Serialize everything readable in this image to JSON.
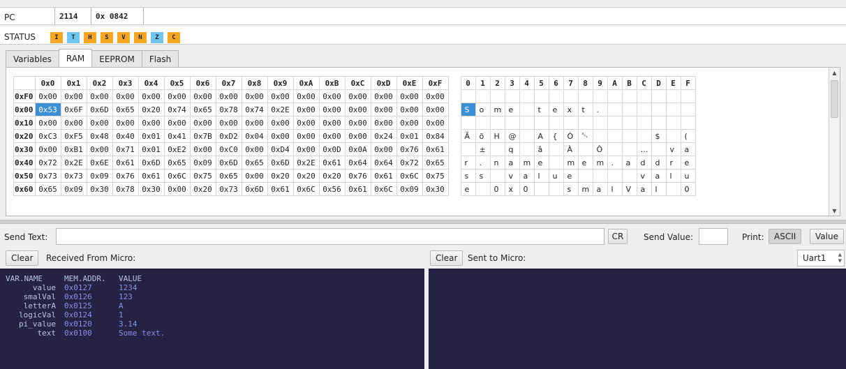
{
  "registers": {
    "pc": {
      "label": "PC",
      "decimal": "2114",
      "hex": "0x 0842"
    },
    "status": {
      "label": "STATUS",
      "flags": [
        {
          "name": "I",
          "color": "#f5a623"
        },
        {
          "name": "T",
          "color": "#6ec6ee"
        },
        {
          "name": "H",
          "color": "#f5a623"
        },
        {
          "name": "S",
          "color": "#f5a623"
        },
        {
          "name": "V",
          "color": "#f5a623"
        },
        {
          "name": "N",
          "color": "#f5a623"
        },
        {
          "name": "Z",
          "color": "#6ec6ee"
        },
        {
          "name": "C",
          "color": "#f5a623"
        }
      ]
    }
  },
  "tabs": [
    {
      "label": "Variables",
      "active": false
    },
    {
      "label": "RAM",
      "active": true
    },
    {
      "label": "EEPROM",
      "active": false
    },
    {
      "label": "Flash",
      "active": false
    }
  ],
  "memory": {
    "hex_columns": [
      "0x0",
      "0x1",
      "0x2",
      "0x3",
      "0x4",
      "0x5",
      "0x6",
      "0x7",
      "0x8",
      "0x9",
      "0xA",
      "0xB",
      "0xC",
      "0xD",
      "0xE",
      "0xF"
    ],
    "ascii_columns": [
      "0",
      "1",
      "2",
      "3",
      "4",
      "5",
      "6",
      "7",
      "8",
      "9",
      "A",
      "B",
      "C",
      "D",
      "E",
      "F"
    ],
    "selected": {
      "row": 1,
      "col": 0
    },
    "rows": [
      {
        "addr": "0xF0",
        "hex": [
          "0x00",
          "0x00",
          "0x00",
          "0x00",
          "0x00",
          "0x00",
          "0x00",
          "0x00",
          "0x00",
          "0x00",
          "0x00",
          "0x00",
          "0x00",
          "0x00",
          "0x00",
          "0x00"
        ],
        "ascii": [
          "",
          "",
          "",
          "",
          "",
          "",
          "",
          "",
          "",
          "",
          "",
          "",
          "",
          "",
          "",
          ""
        ]
      },
      {
        "addr": "0x00",
        "hex": [
          "0x53",
          "0x6F",
          "0x6D",
          "0x65",
          "0x20",
          "0x74",
          "0x65",
          "0x78",
          "0x74",
          "0x2E",
          "0x00",
          "0x00",
          "0x00",
          "0x00",
          "0x00",
          "0x00"
        ],
        "ascii": [
          "S",
          "o",
          "m",
          "e",
          "",
          "t",
          "e",
          "x",
          "t",
          ".",
          "",
          "",
          "",
          "",
          "",
          ""
        ]
      },
      {
        "addr": "0x10",
        "hex": [
          "0x00",
          "0x00",
          "0x00",
          "0x00",
          "0x00",
          "0x00",
          "0x00",
          "0x00",
          "0x00",
          "0x00",
          "0x00",
          "0x00",
          "0x00",
          "0x00",
          "0x00",
          "0x00"
        ],
        "ascii": [
          "",
          "",
          "",
          "",
          "",
          "",
          "",
          "",
          "",
          "",
          "",
          "",
          "",
          "",
          "",
          ""
        ]
      },
      {
        "addr": "0x20",
        "hex": [
          "0xC3",
          "0xF5",
          "0x48",
          "0x40",
          "0x01",
          "0x41",
          "0x7B",
          "0xD2",
          "0x04",
          "0x00",
          "0x00",
          "0x00",
          "0x00",
          "0x24",
          "0x01",
          "0x84"
        ],
        "ascii": [
          "Ã",
          "õ",
          "H",
          "@",
          "",
          "A",
          "{",
          "Ò",
          "␄",
          "",
          "",
          "",
          "",
          "$",
          "",
          "("
        ]
      },
      {
        "addr": "0x30",
        "hex": [
          "0x00",
          "0xB1",
          "0x00",
          "0x71",
          "0x01",
          "0xE2",
          "0x00",
          "0xC0",
          "0x00",
          "0xD4",
          "0x00",
          "0x0D",
          "0x0A",
          "0x00",
          "0x76",
          "0x61"
        ],
        "ascii": [
          "",
          "±",
          "",
          "q",
          "",
          "â",
          "",
          "À",
          "",
          "Ô",
          "",
          "",
          "…",
          "",
          "v",
          "a"
        ]
      },
      {
        "addr": "0x40",
        "hex": [
          "0x72",
          "0x2E",
          "0x6E",
          "0x61",
          "0x6D",
          "0x65",
          "0x09",
          "0x6D",
          "0x65",
          "0x6D",
          "0x2E",
          "0x61",
          "0x64",
          "0x64",
          "0x72",
          "0x65"
        ],
        "ascii": [
          "r",
          ".",
          "n",
          "a",
          "m",
          "e",
          "",
          "m",
          "e",
          "m",
          ".",
          "a",
          "d",
          "d",
          "r",
          "e"
        ]
      },
      {
        "addr": "0x50",
        "hex": [
          "0x73",
          "0x73",
          "0x09",
          "0x76",
          "0x61",
          "0x6C",
          "0x75",
          "0x65",
          "0x00",
          "0x20",
          "0x20",
          "0x20",
          "0x76",
          "0x61",
          "0x6C",
          "0x75"
        ],
        "ascii": [
          "s",
          "s",
          "",
          "v",
          "a",
          "l",
          "u",
          "e",
          "",
          "",
          "",
          "",
          "v",
          "a",
          "l",
          "u"
        ]
      },
      {
        "addr": "0x60",
        "hex": [
          "0x65",
          "0x09",
          "0x30",
          "0x78",
          "0x30",
          "0x00",
          "0x20",
          "0x73",
          "0x6D",
          "0x61",
          "0x6C",
          "0x56",
          "0x61",
          "0x6C",
          "0x09",
          "0x30"
        ],
        "ascii": [
          "e",
          "",
          "0",
          "x",
          "0",
          "",
          "",
          "s",
          "m",
          "a",
          "l",
          "V",
          "a",
          "l",
          "",
          "0"
        ]
      }
    ]
  },
  "send": {
    "text_label": "Send Text:",
    "cr_label": "CR",
    "value_label": "Send Value:",
    "print_label": "Print:",
    "ascii_label": "ASCII",
    "value_btn_label": "Value"
  },
  "received": {
    "clear_label": "Clear",
    "title": "Received From Micro:"
  },
  "sent": {
    "clear_label": "Clear",
    "title": "Sent to Micro:"
  },
  "uart": {
    "selected": "Uart1"
  },
  "console_received": {
    "header": [
      "VAR.NAME",
      "MEM.ADDR.",
      "VALUE"
    ],
    "lines": [
      [
        "value",
        "0x0127",
        "1234"
      ],
      [
        "smalVal",
        "0x0126",
        "123"
      ],
      [
        "letterA",
        "0x0125",
        "A"
      ],
      [
        "logicVal",
        "0x0124",
        "1"
      ],
      [
        "pi_value",
        "0x0120",
        "3.14"
      ],
      [
        "text",
        "0x0100",
        "Some text."
      ]
    ]
  }
}
